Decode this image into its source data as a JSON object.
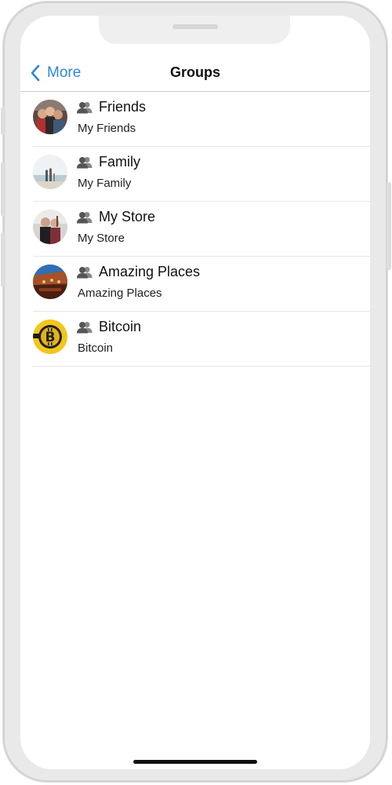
{
  "nav": {
    "back_label": "More",
    "title": "Groups"
  },
  "groups": [
    {
      "name": "Friends",
      "subtitle": "My Friends",
      "avatar": "friends-photo-avatar"
    },
    {
      "name": "Family",
      "subtitle": "My Family",
      "avatar": "family-beach-photo-avatar"
    },
    {
      "name": "My Store",
      "subtitle": "My Store",
      "avatar": "store-photo-avatar"
    },
    {
      "name": "Amazing Places",
      "subtitle": "Amazing Places",
      "avatar": "place-photo-avatar"
    },
    {
      "name": "Bitcoin",
      "subtitle": "Bitcoin",
      "avatar": "bitcoin-coin-avatar"
    }
  ],
  "icons": {
    "back": "chevron-left-icon",
    "group": "people-icon"
  },
  "colors": {
    "accent": "#2f86e0",
    "title_text": "#111111",
    "divider": "#e6e6e6"
  }
}
